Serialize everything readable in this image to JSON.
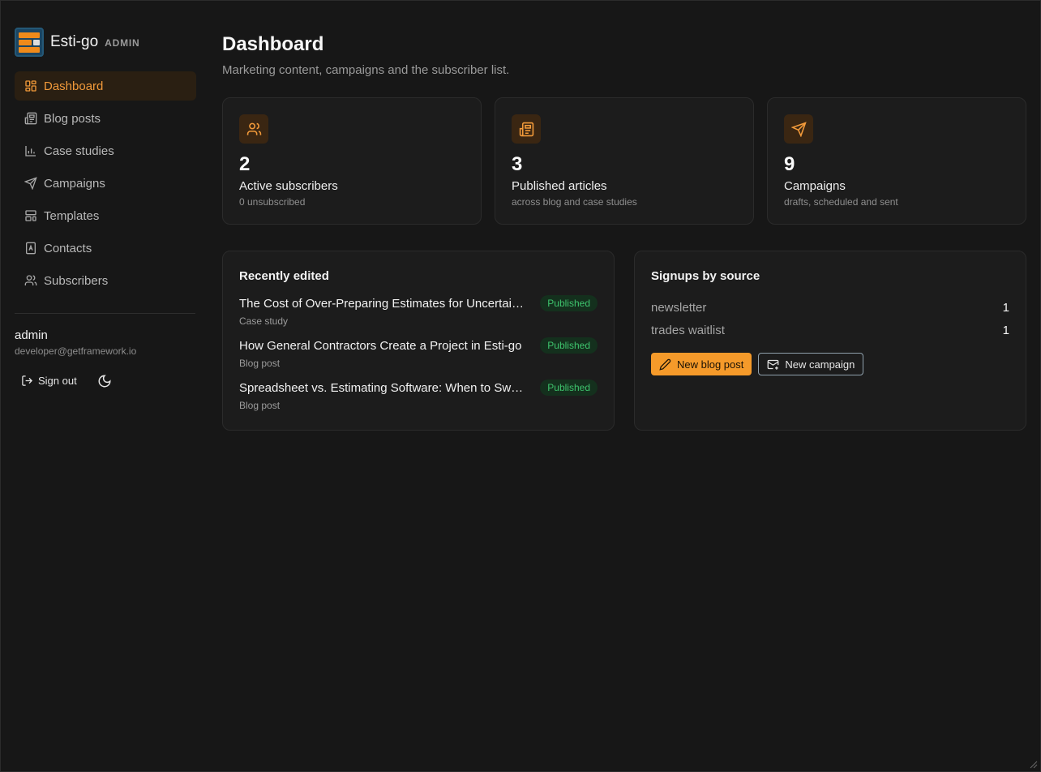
{
  "brand": {
    "name": "Esti-go",
    "tag": "ADMIN"
  },
  "sidebar": {
    "items": [
      {
        "label": "Dashboard",
        "icon": "dashboard-icon",
        "active": true
      },
      {
        "label": "Blog posts",
        "icon": "newspaper-icon"
      },
      {
        "label": "Case studies",
        "icon": "bar-chart-icon"
      },
      {
        "label": "Campaigns",
        "icon": "send-icon"
      },
      {
        "label": "Templates",
        "icon": "layout-icon"
      },
      {
        "label": "Contacts",
        "icon": "contact-book-icon"
      },
      {
        "label": "Subscribers",
        "icon": "users-icon"
      }
    ],
    "user": {
      "name": "admin",
      "email": "developer@getframework.io"
    },
    "sign_out_label": "Sign out"
  },
  "header": {
    "title": "Dashboard",
    "subtitle": "Marketing content, campaigns and the subscriber list."
  },
  "stats": [
    {
      "value": "2",
      "label": "Active subscribers",
      "sub": "0 unsubscribed",
      "icon": "users-icon"
    },
    {
      "value": "3",
      "label": "Published articles",
      "sub": "across blog and case studies",
      "icon": "newspaper-icon"
    },
    {
      "value": "9",
      "label": "Campaigns",
      "sub": "drafts, scheduled and sent",
      "icon": "send-icon"
    }
  ],
  "recent": {
    "title": "Recently edited",
    "items": [
      {
        "title": "The Cost of Over-Preparing Estimates for Uncertain...",
        "type": "Case study",
        "status": "Published"
      },
      {
        "title": "How General Contractors Create a Project in Esti-go",
        "type": "Blog post",
        "status": "Published"
      },
      {
        "title": "Spreadsheet vs. Estimating Software: When to Switch",
        "type": "Blog post",
        "status": "Published"
      }
    ]
  },
  "signups": {
    "title": "Signups by source",
    "rows": [
      {
        "source": "newsletter",
        "count": "1"
      },
      {
        "source": "trades waitlist",
        "count": "1"
      }
    ],
    "new_blog_label": "New blog post",
    "new_campaign_label": "New campaign"
  },
  "colors": {
    "accent": "#f59a2a",
    "active_nav_bg": "#2a1f12",
    "badge_green": "#3ec46d",
    "background": "#171717",
    "card": "#1c1c1c"
  }
}
